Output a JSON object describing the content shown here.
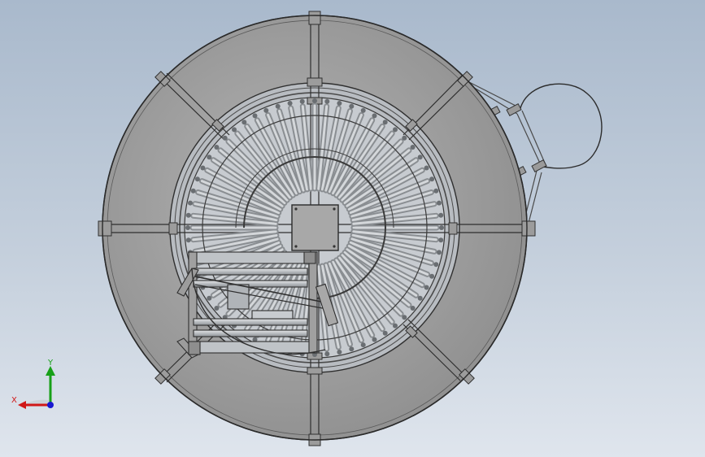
{
  "viewport": {
    "background_top": "#a9b9cc",
    "background_bottom": "#dfe5ed"
  },
  "model": {
    "outline_color": "#3c3c3c",
    "face_color": "#a8a8a8",
    "roller_color": "#c9ccd0",
    "icon": "circular-roller-conveyor-model"
  },
  "triad": {
    "x_label": "X",
    "y_label": "Y",
    "x_color": "#d01818",
    "y_color": "#18a018",
    "z_color": "#1818d0"
  }
}
